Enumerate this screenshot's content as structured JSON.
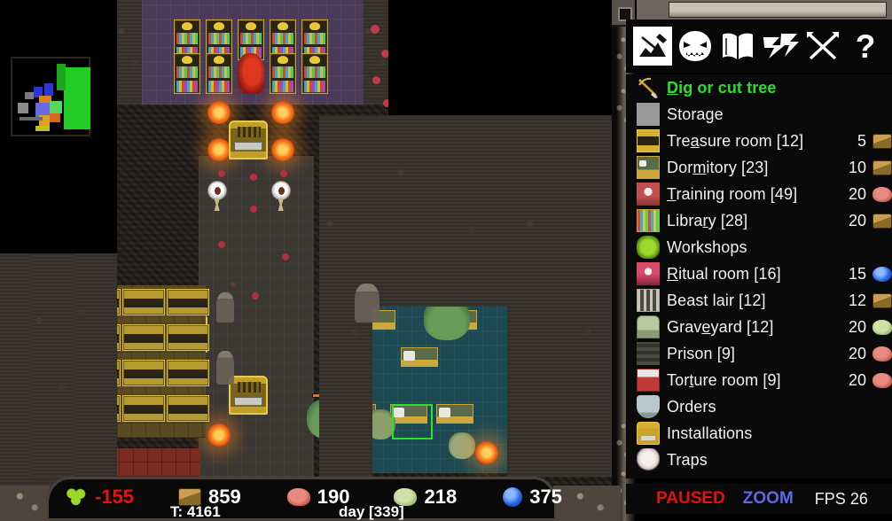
{
  "toolbar": {
    "items": [
      {
        "name": "dig-build-icon",
        "label": "Build",
        "selected": true
      },
      {
        "name": "minion-face-icon",
        "label": "Minions",
        "selected": false
      },
      {
        "name": "book-icon",
        "label": "Technology",
        "selected": false
      },
      {
        "name": "lightning-icon",
        "label": "Magic",
        "selected": false
      },
      {
        "name": "crossed-swords-icon",
        "label": "Battle",
        "selected": false
      },
      {
        "name": "question-mark-icon",
        "label": "Help",
        "selected": false
      }
    ]
  },
  "menu": {
    "items": [
      {
        "icon": "pickaxe-icon",
        "label": "Dig or cut tree",
        "hotkey_index": 0,
        "cost": "",
        "resource": "",
        "highlighted": true
      },
      {
        "icon": "storage-box-icon",
        "label": "Storage",
        "hotkey_index": -1,
        "cost": "",
        "resource": "",
        "highlighted": false
      },
      {
        "icon": "treasure-chest-icon",
        "label": "Treasure room [12]",
        "hotkey_index": 3,
        "cost": "5",
        "resource": "wood",
        "highlighted": false
      },
      {
        "icon": "bed-icon",
        "label": "Dormitory [23]",
        "hotkey_index": 3,
        "cost": "10",
        "resource": "wood",
        "highlighted": false
      },
      {
        "icon": "training-dummy-icon",
        "label": "Training room [49]",
        "hotkey_index": 0,
        "cost": "20",
        "resource": "stone",
        "highlighted": false
      },
      {
        "icon": "bookshelf-icon",
        "label": "Library [28]",
        "hotkey_index": 5,
        "cost": "20",
        "resource": "wood",
        "highlighted": false
      },
      {
        "icon": "workshop-icon",
        "label": "Workshops",
        "hotkey_index": -1,
        "cost": "",
        "resource": "",
        "highlighted": false
      },
      {
        "icon": "ritual-altar-icon",
        "label": "Ritual room [16]",
        "hotkey_index": 0,
        "cost": "15",
        "resource": "mana",
        "highlighted": false
      },
      {
        "icon": "beast-cage-icon",
        "label": "Beast lair [12]",
        "hotkey_index": -1,
        "cost": "12",
        "resource": "wood",
        "highlighted": false
      },
      {
        "icon": "tombstone-icon",
        "label": "Graveyard [12]",
        "hotkey_index": 4,
        "cost": "20",
        "resource": "green-stone",
        "highlighted": false
      },
      {
        "icon": "prison-bars-icon",
        "label": "Prison [9]",
        "hotkey_index": -1,
        "cost": "20",
        "resource": "stone",
        "highlighted": false
      },
      {
        "icon": "torture-rack-icon",
        "label": "Torture room [9]",
        "hotkey_index": 3,
        "cost": "20",
        "resource": "stone",
        "highlighted": false
      },
      {
        "icon": "banner-icon",
        "label": "Orders",
        "hotkey_index": -1,
        "cost": "",
        "resource": "",
        "highlighted": false
      },
      {
        "icon": "installation-icon",
        "label": "Installations",
        "hotkey_index": -1,
        "cost": "",
        "resource": "",
        "highlighted": false
      },
      {
        "icon": "skull-icon",
        "label": "Traps",
        "hotkey_index": -1,
        "cost": "",
        "resource": "",
        "highlighted": false
      }
    ]
  },
  "status": {
    "paused_label": "PAUSED",
    "zoom_label": "ZOOM",
    "fps_label": "FPS",
    "fps_value": "26",
    "paused_color": "#e81010",
    "zoom_color": "#5a6ae8"
  },
  "resources": [
    {
      "icon": "gold-icon",
      "value": "-155",
      "negative": true
    },
    {
      "icon": "wood-icon",
      "value": "859",
      "negative": false
    },
    {
      "icon": "stone-icon",
      "value": "190",
      "negative": false
    },
    {
      "icon": "green-stone-icon",
      "value": "218",
      "negative": false
    },
    {
      "icon": "mana-icon",
      "value": "375",
      "negative": false
    }
  ],
  "footer": {
    "turn": "T: 4161",
    "day": "day [339]"
  },
  "colors": {
    "highlight_green": "#25e225",
    "text_white": "#f2f2f2",
    "negative_red": "#e81010"
  }
}
